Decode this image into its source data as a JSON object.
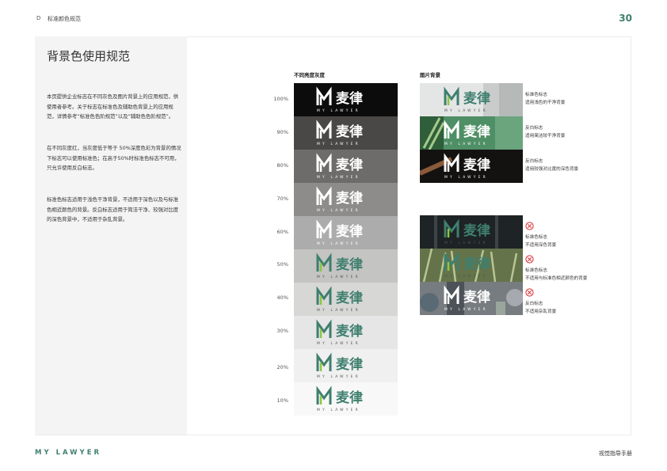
{
  "header": {
    "code": "D",
    "title": "标准颜色规范",
    "page": "30"
  },
  "section_title": "背景色使用规范",
  "paragraphs": [
    "本页提供企业标志在不同灰色及图片背景上的应用规范，供使用者参考。关于标志在标准色及辅助色背景上的应用规范，详情参考“标准色色阶规范”以及“辅助色色阶规范”。",
    "在不同灰度红，当灰度低于等于 50%深度色彩为背景的情况下标志可以使用标准色；在高于50%时标准色标志不可用，只允许使用反白标志。",
    "标准色标志适用于浅色干净背景，不适用于深色以及与标准色相近颜色的背景。反白标志适用于简洁干净、较强对比度的深色背景中，不适用于杂乱背景。"
  ],
  "gray_column": {
    "title": "不同亮度灰度",
    "rows": [
      {
        "label": "100%",
        "bg": "#0c0c0c",
        "logo": "white"
      },
      {
        "label": "90%",
        "bg": "#4a4846",
        "logo": "white"
      },
      {
        "label": "80%",
        "bg": "#6e6c6b",
        "logo": "white"
      },
      {
        "label": "70%",
        "bg": "#8d8c8b",
        "logo": "white"
      },
      {
        "label": "60%",
        "bg": "#adacac",
        "logo": "white"
      },
      {
        "label": "50%",
        "bg": "#c4c4c3",
        "logo": "green"
      },
      {
        "label": "40%",
        "bg": "#d7d7d6",
        "logo": "green"
      },
      {
        "label": "30%",
        "bg": "#e6e6e6",
        "logo": "green"
      },
      {
        "label": "20%",
        "bg": "#f0f0f0",
        "logo": "green"
      },
      {
        "label": "10%",
        "bg": "#f8f8f8",
        "logo": "green"
      }
    ]
  },
  "image_column": {
    "title": "图片背景",
    "good": [
      {
        "line1": "标准色标志",
        "line2": "适用浅色的干净背景",
        "logo": "green",
        "bg": "#dcdedd"
      },
      {
        "line1": "反白标志",
        "line2": "适用简洁较干净背景",
        "logo": "white",
        "bg": "#4c8a64"
      },
      {
        "line1": "反白标志",
        "line2": "适用较强对比度的深色背景",
        "logo": "white",
        "bg": "#151312"
      }
    ],
    "bad": [
      {
        "line1": "标准色标志",
        "line2": "不适用深色背景",
        "logo": "green",
        "bg": "#23282a"
      },
      {
        "line1": "标准色标志",
        "line2": "不适用与标准色相近颜色的背景",
        "logo": "green",
        "bg": "#6f7c52"
      },
      {
        "line1": "反白标志",
        "line2": "不适用杂乱背景",
        "logo": "white",
        "bg": "#6d7277"
      }
    ]
  },
  "logo": {
    "cn": "麦律",
    "en": "MY LAWYER"
  },
  "colors": {
    "brand_green": "#3f7f6e",
    "light_green": "#8dc63f",
    "alert_red": "#d9282f"
  },
  "footer": {
    "brand": "MY LAWYER",
    "right": "视觉指导手册"
  }
}
